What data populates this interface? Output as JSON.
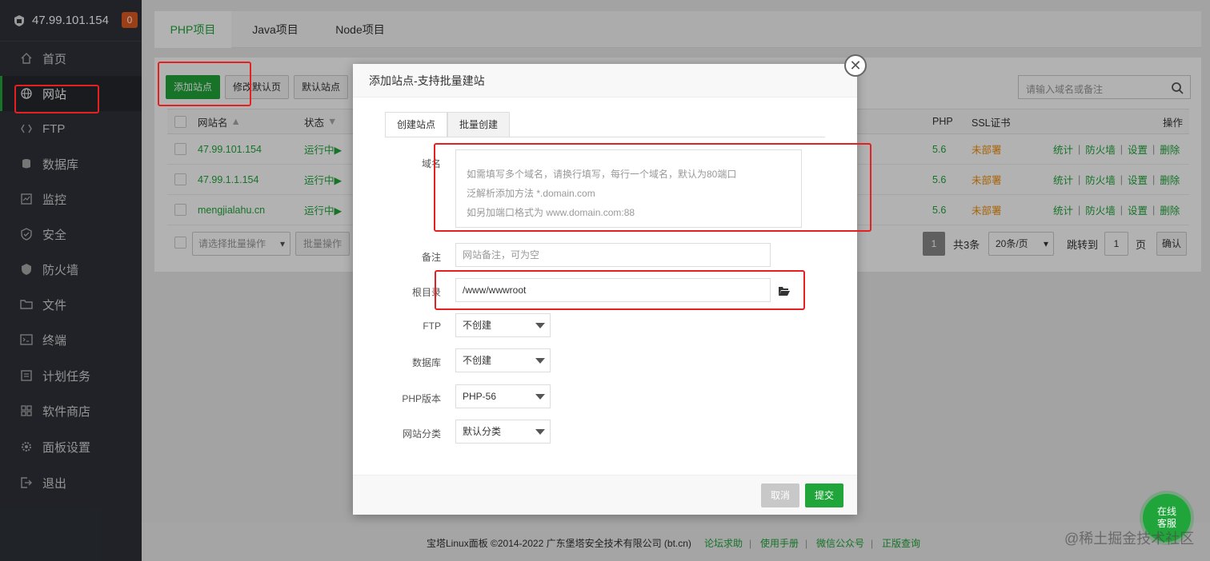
{
  "sidebar": {
    "server_ip": "47.99.101.154",
    "badge": "0",
    "items": [
      {
        "label": "首页",
        "icon": "home-icon"
      },
      {
        "label": "网站",
        "icon": "globe-icon"
      },
      {
        "label": "FTP",
        "icon": "ftp-icon"
      },
      {
        "label": "数据库",
        "icon": "database-icon"
      },
      {
        "label": "监控",
        "icon": "monitor-icon"
      },
      {
        "label": "安全",
        "icon": "shield-icon"
      },
      {
        "label": "防火墙",
        "icon": "firewall-icon"
      },
      {
        "label": "文件",
        "icon": "folder-icon"
      },
      {
        "label": "终端",
        "icon": "terminal-icon"
      },
      {
        "label": "计划任务",
        "icon": "clock-icon"
      },
      {
        "label": "软件商店",
        "icon": "grid-icon"
      },
      {
        "label": "面板设置",
        "icon": "gear-icon"
      },
      {
        "label": "退出",
        "icon": "logout-icon"
      }
    ]
  },
  "tabs": [
    "PHP项目",
    "Java项目",
    "Node项目"
  ],
  "toolbar": {
    "add_site": "添加站点",
    "modify_default": "修改默认页",
    "default_site": "默认站点",
    "search_placeholder": "请输入域名或备注"
  },
  "table": {
    "headers": {
      "name": "网站名",
      "status": "状态",
      "php": "PHP",
      "ssl": "SSL证书",
      "ops": "操作"
    },
    "rows": [
      {
        "name": "47.99.101.154",
        "status": "运行中▶",
        "php": "5.6",
        "ssl": "未部署"
      },
      {
        "name": "47.99.1.1.154",
        "status": "运行中▶",
        "php": "5.6",
        "ssl": "未部署"
      },
      {
        "name": "mengjialahu.cn",
        "status": "运行中▶",
        "php": "5.6",
        "ssl": "未部署"
      }
    ],
    "row_ops": [
      "统计",
      "防火墙",
      "设置",
      "删除"
    ],
    "batch_select": "请选择批量操作",
    "batch_btn": "批量操作"
  },
  "pagination": {
    "current": "1",
    "total": "共3条",
    "per_page": "20条/页",
    "jump_label": "跳转到",
    "jump_value": "1",
    "page_unit": "页",
    "confirm": "确认"
  },
  "modal": {
    "title": "添加站点-支持批量建站",
    "tab_create": "创建站点",
    "tab_batch": "批量创建",
    "domain_label": "域名",
    "domain_hint_1": "如需填写多个域名，请换行填写，每行一个域名，默认为80端口",
    "domain_hint_2": "泛解析添加方法 *.domain.com",
    "domain_hint_3": "如另加端口格式为 www.domain.com:88",
    "remark_label": "备注",
    "remark_placeholder": "网站备注，可为空",
    "root_label": "根目录",
    "root_value": "/www/wwwroot",
    "ftp_label": "FTP",
    "ftp_value": "不创建",
    "db_label": "数据库",
    "db_value": "不创建",
    "php_label": "PHP版本",
    "php_value": "PHP-56",
    "category_label": "网站分类",
    "category_value": "默认分类",
    "cancel": "取消",
    "submit": "提交"
  },
  "footer": {
    "copyright": "宝塔Linux面板 ©2014-2022 广东堡塔安全技术有限公司 (bt.cn)",
    "links": [
      "论坛求助",
      "使用手册",
      "微信公众号",
      "正版查询"
    ]
  },
  "service_bubble": {
    "line1": "在线",
    "line2": "客服"
  },
  "watermark": "@稀土掘金技术社区"
}
